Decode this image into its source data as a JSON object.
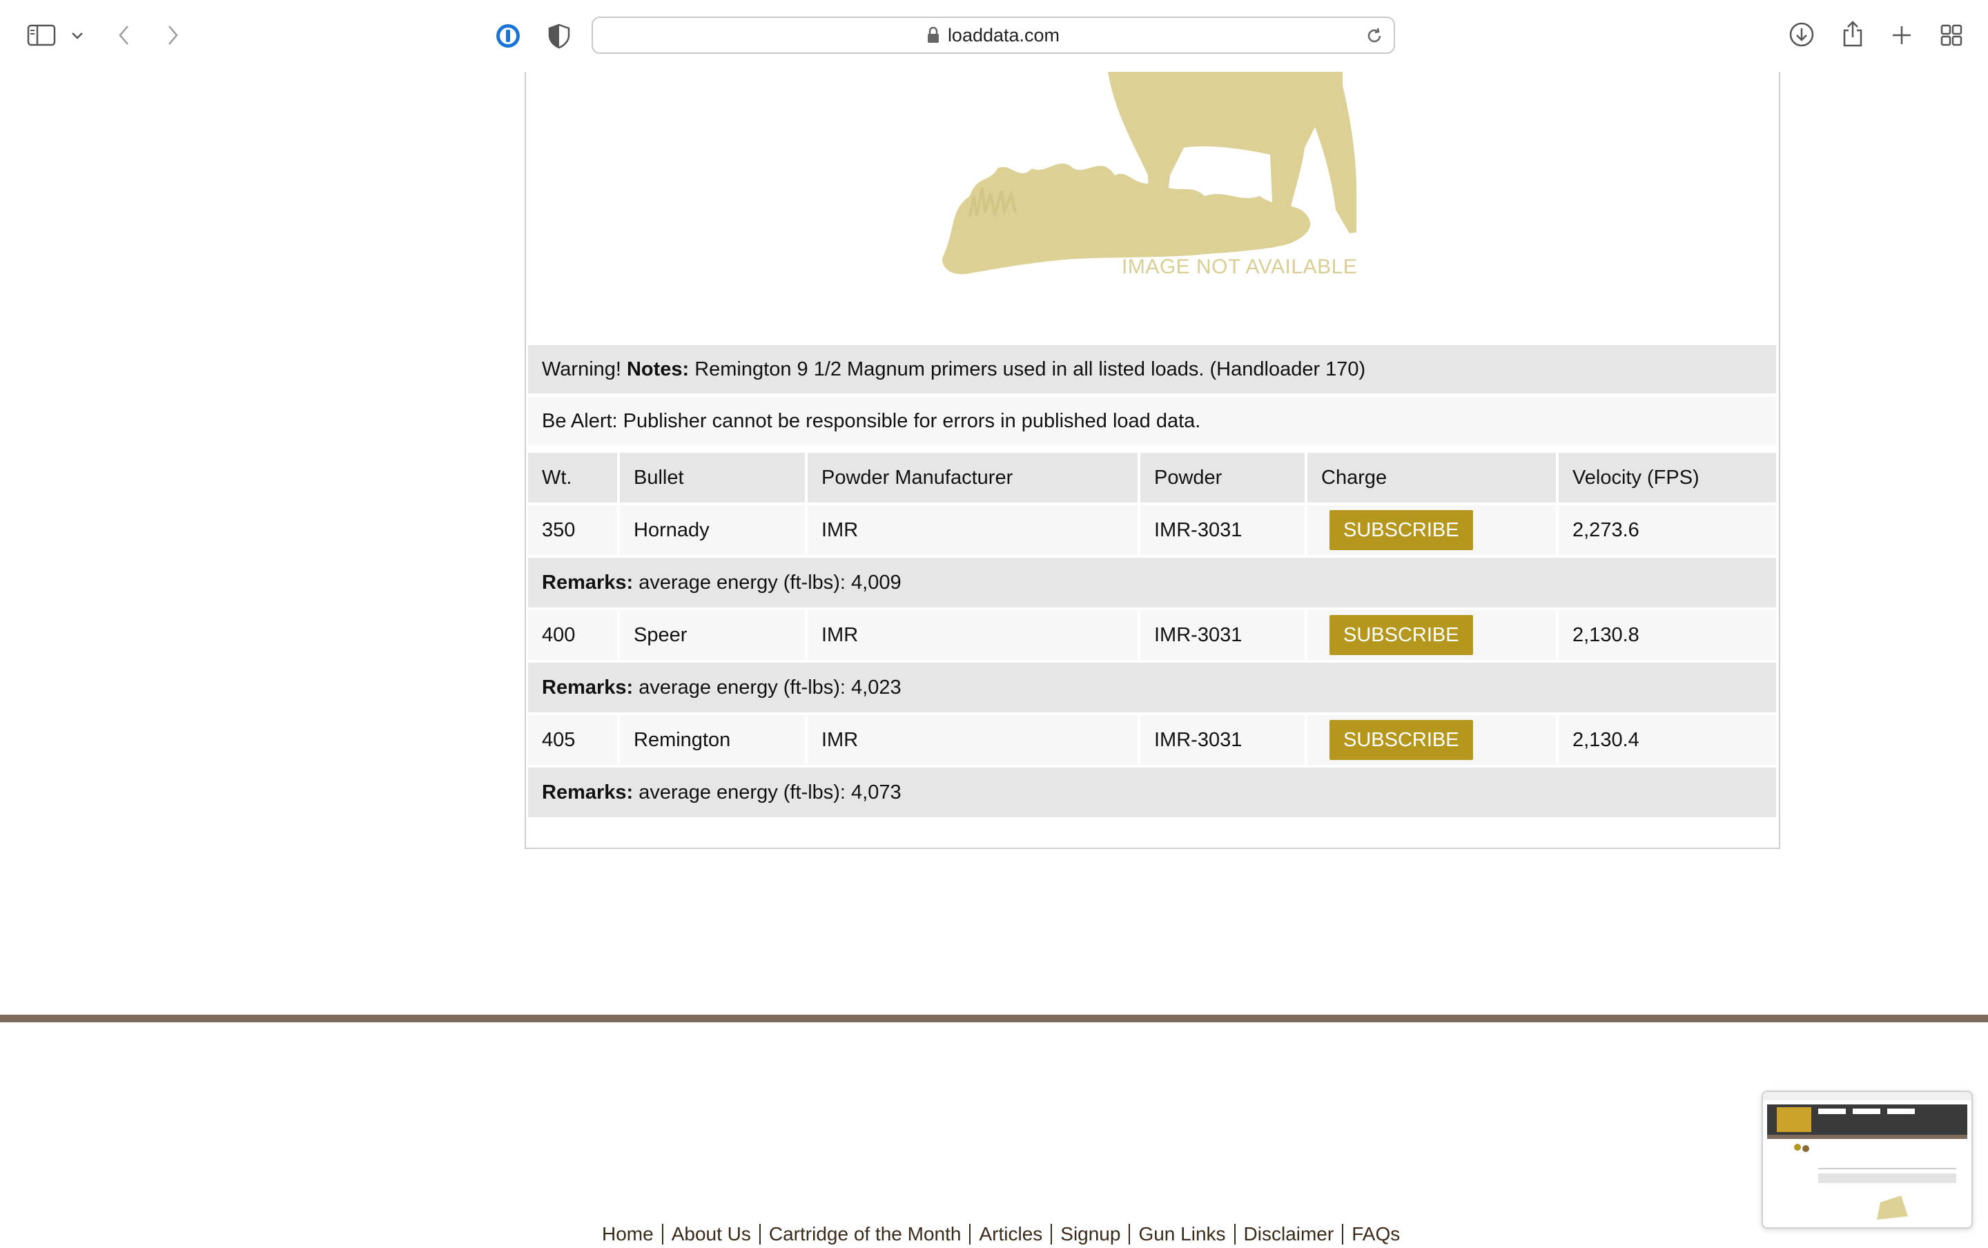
{
  "browser": {
    "url": "loaddata.com"
  },
  "page": {
    "image_placeholder": "IMAGE NOT AVAILABLE",
    "notes_prefix": "Warning!",
    "notes_label": "Notes:",
    "notes_text": "Remington 9 1/2 Magnum primers used in all listed loads. (Handloader 170)",
    "alert_text": "Be Alert: Publisher cannot be responsible for errors in published load data.",
    "table": {
      "headers": [
        "Wt.",
        "Bullet",
        "Powder Manufacturer",
        "Powder",
        "Charge",
        "Velocity (FPS)"
      ],
      "rows": [
        {
          "wt": "350",
          "bullet": "Hornady",
          "manufacturer": "IMR",
          "powder": "IMR-3031",
          "charge": "SUBSCRIBE",
          "velocity": "2,273.6",
          "remarks_label": "Remarks:",
          "remarks": "average energy (ft-lbs): 4,009"
        },
        {
          "wt": "400",
          "bullet": "Speer",
          "manufacturer": "IMR",
          "powder": "IMR-3031",
          "charge": "SUBSCRIBE",
          "velocity": "2,130.8",
          "remarks_label": "Remarks:",
          "remarks": "average energy (ft-lbs): 4,023"
        },
        {
          "wt": "405",
          "bullet": "Remington",
          "manufacturer": "IMR",
          "powder": "IMR-3031",
          "charge": "SUBSCRIBE",
          "velocity": "2,130.4",
          "remarks_label": "Remarks:",
          "remarks": "average energy (ft-lbs): 4,073"
        }
      ]
    }
  },
  "footer": {
    "links": [
      "Home",
      "About Us",
      "Cartridge of the Month",
      "Articles",
      "Signup",
      "Gun Links",
      "Disclaimer",
      "FAQs"
    ]
  },
  "colors": {
    "subscribe_button": "#b5971e",
    "footer_rule": "#7d6a5a",
    "placeholder_tan": "#dcd094"
  }
}
